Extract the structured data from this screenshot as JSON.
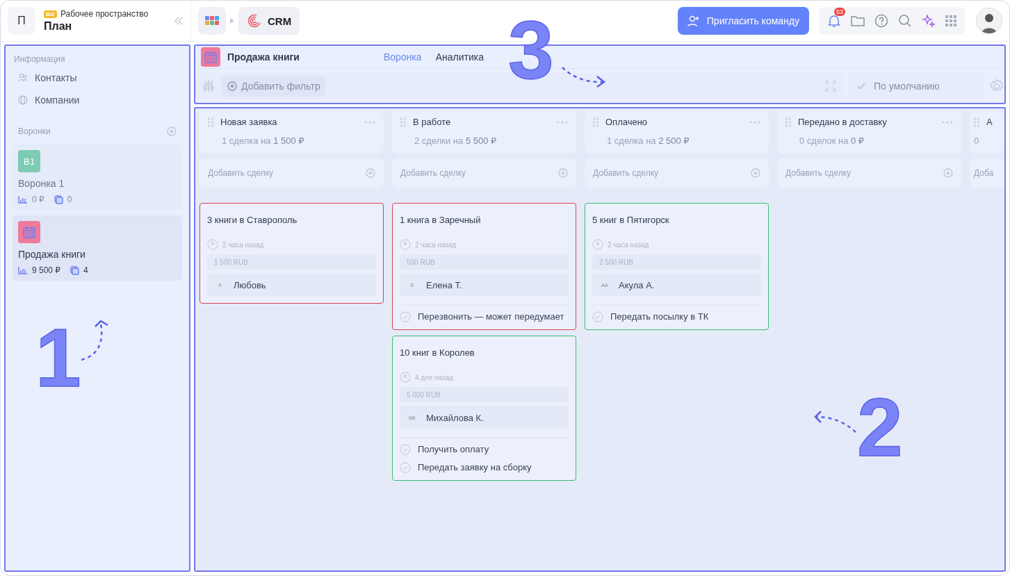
{
  "workspace": {
    "initial": "П",
    "badge": "BIZ",
    "label": "Рабочее пространство",
    "name": "План"
  },
  "breadcrumb": {
    "app": "CRM"
  },
  "invite_button": "Пригласить команду",
  "notifications": {
    "count": "53"
  },
  "sidebar": {
    "section": "Информация",
    "items": [
      {
        "kind": "contacts",
        "label": "Контакты"
      },
      {
        "kind": "companies",
        "label": "Компании"
      }
    ],
    "funnels_title": "Воронки",
    "funnels": [
      {
        "kind": "initials",
        "badge": "В1",
        "name": "Воронка 1",
        "amount": "0 ₽",
        "count": "0",
        "selected": false,
        "color": "#7dcbb2"
      },
      {
        "kind": "calendar",
        "name": "Продажа книги",
        "amount": "9 500 ₽",
        "count": "4",
        "selected": true,
        "color": "#ee7a9b"
      }
    ]
  },
  "pipeline": {
    "title": "Продажа книги",
    "color": "#ee7a9b",
    "tabs": [
      {
        "label": "Воронка",
        "selected": true
      },
      {
        "label": "Аналитика",
        "selected": false
      }
    ],
    "filter_button": "Добавить фильтр",
    "view": "По умолчанию"
  },
  "columns": [
    {
      "title": "Новая заявка",
      "summary": "1 сделка на **1 500 ₽**",
      "add_label": "Добавить сделку",
      "deals": [
        {
          "title": "3 книги в Ставрополь",
          "time": "2 часа назад",
          "amount": "1 500 RUB",
          "initials": "Л",
          "contact": "Любовь",
          "color": "#d9424f"
        }
      ]
    },
    {
      "title": "В работе",
      "summary": "2 сделки на **5 500 ₽**",
      "add_label": "Добавить сделку",
      "deals": [
        {
          "title": "1 книга в Заречный",
          "time": "2 часа назад",
          "amount": "500 RUB",
          "initials": "Е",
          "contact": "Елена Т.",
          "color": "#d9424f",
          "tasks": [
            "Перезвонить — может передумает"
          ]
        },
        {
          "title": "10 книг в Королев",
          "time": "4 дня назад",
          "amount": "5 000 RUB",
          "initials": "МК",
          "contact": "Михайлова К.",
          "color": "#3dbb6a",
          "tasks": [
            "Получить оплату",
            "Передать заявку на сборку"
          ]
        }
      ]
    },
    {
      "title": "Оплачено",
      "summary": "1 сделка на **2 500 ₽**",
      "add_label": "Добавить сделку",
      "deals": [
        {
          "title": "5 книг в Пятигорск",
          "time": "2 часа назад",
          "amount": "2 500 RUB",
          "initials": "АА",
          "contact": "Акула А.",
          "color": "#3dbb6a",
          "tasks": [
            "Передать посылку в ТК"
          ]
        }
      ]
    },
    {
      "title": "Передано в доставку",
      "summary": "0 сделок на **0 ₽**",
      "add_label": "Добавить сделку"
    },
    {
      "title": "А",
      "summary": "0",
      "add_label": "Доба"
    }
  ],
  "callouts": [
    {
      "label": "1"
    },
    {
      "label": "2"
    },
    {
      "label": "3"
    }
  ]
}
